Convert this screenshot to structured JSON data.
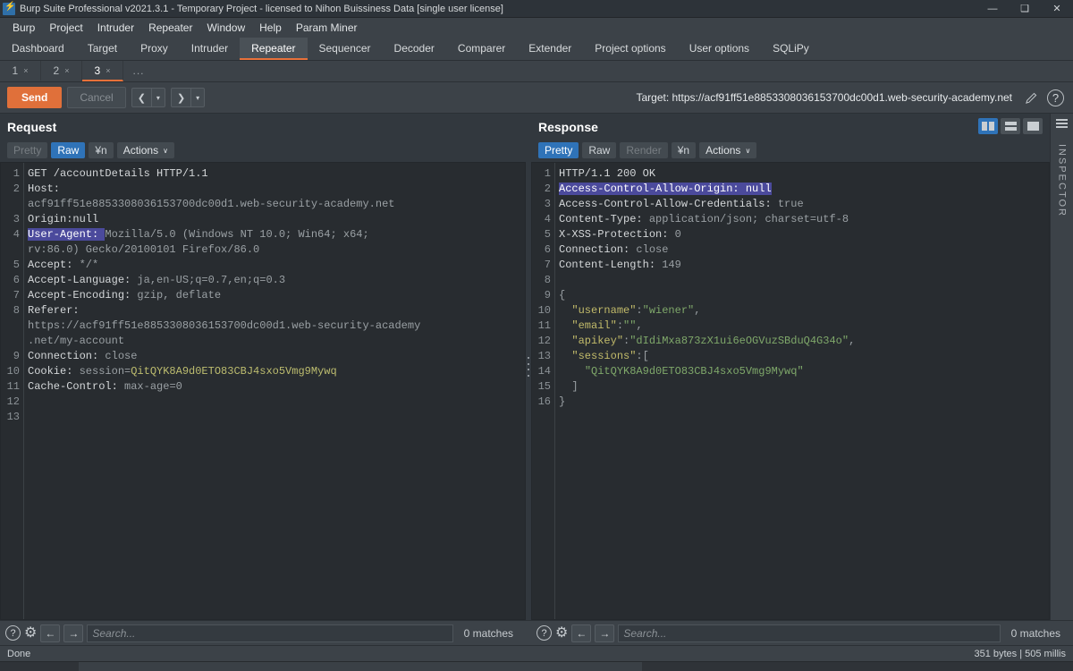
{
  "window": {
    "title": "Burp Suite Professional v2021.3.1 - Temporary Project - licensed to Nihon Buissiness Data [single user license]",
    "logo_icon": "burp-logo-icon",
    "minimize": "—",
    "maximize": "❑",
    "close": "✕"
  },
  "menu": {
    "items": [
      {
        "label": "Burp"
      },
      {
        "label": "Project"
      },
      {
        "label": "Intruder"
      },
      {
        "label": "Repeater"
      },
      {
        "label": "Window"
      },
      {
        "label": "Help"
      },
      {
        "label": "Param Miner"
      }
    ]
  },
  "main_tabs": {
    "items": [
      {
        "label": "Dashboard",
        "active": false
      },
      {
        "label": "Target",
        "active": false
      },
      {
        "label": "Proxy",
        "active": false
      },
      {
        "label": "Intruder",
        "active": false
      },
      {
        "label": "Repeater",
        "active": true
      },
      {
        "label": "Sequencer",
        "active": false
      },
      {
        "label": "Decoder",
        "active": false
      },
      {
        "label": "Comparer",
        "active": false
      },
      {
        "label": "Extender",
        "active": false
      },
      {
        "label": "Project options",
        "active": false
      },
      {
        "label": "User options",
        "active": false
      },
      {
        "label": "SQLiPy",
        "active": false
      }
    ]
  },
  "sub_tabs": {
    "items": [
      {
        "label": "1",
        "close": "×",
        "active": false
      },
      {
        "label": "2",
        "close": "×",
        "active": false
      },
      {
        "label": "3",
        "close": "×",
        "active": true
      }
    ],
    "more_label": "..."
  },
  "toolbar": {
    "send_label": "Send",
    "cancel_label": "Cancel",
    "back_icon": "chevron-left-icon",
    "back_caret": "▾",
    "forward_icon": "chevron-right-icon",
    "forward_caret": "▾",
    "target_label": "Target: https://acf91ff51e8853308036153700dc00d1.web-security-academy.net",
    "edit_icon": "pencil-icon",
    "help_icon": "question-mark-icon",
    "help_glyph": "?"
  },
  "request": {
    "title": "Request",
    "view_tabs": [
      {
        "label": "Pretty",
        "state": "disabled"
      },
      {
        "label": "Raw",
        "state": "active"
      },
      {
        "label": "¥n",
        "state": "plain"
      },
      {
        "label": "Actions",
        "state": "actions",
        "caret": "∨"
      }
    ],
    "line_numbers": [
      "1",
      "2",
      "",
      "3",
      "4",
      "",
      "5",
      "6",
      "7",
      "8",
      "",
      "",
      "9",
      "10",
      "11",
      "12",
      "13"
    ],
    "lines": [
      {
        "segments": [
          {
            "text": "GET /accountDetails HTTP/1.1",
            "cls": "hdr"
          }
        ]
      },
      {
        "segments": [
          {
            "text": "Host: ",
            "cls": "hdr"
          }
        ]
      },
      {
        "segments": [
          {
            "text": "acf91ff51e8853308036153700dc00d1.web-security-academy.net",
            "cls": "val"
          }
        ]
      },
      {
        "segments": [
          {
            "text": "Origin:null",
            "cls": "hdr"
          }
        ]
      },
      {
        "segments": [
          {
            "text": "User-Agent: ",
            "cls": "sel"
          },
          {
            "text": "Mozilla/5.0 (Windows NT 10.0; Win64; x64;",
            "cls": "val"
          }
        ]
      },
      {
        "segments": [
          {
            "text": "rv:86.0) Gecko/20100101 Firefox/86.0",
            "cls": "val"
          }
        ]
      },
      {
        "segments": [
          {
            "text": "Accept: ",
            "cls": "hdr"
          },
          {
            "text": "*/*",
            "cls": "val"
          }
        ]
      },
      {
        "segments": [
          {
            "text": "Accept-Language: ",
            "cls": "hdr"
          },
          {
            "text": "ja,en-US;q=0.7,en;q=0.3",
            "cls": "val"
          }
        ]
      },
      {
        "segments": [
          {
            "text": "Accept-Encoding: ",
            "cls": "hdr"
          },
          {
            "text": "gzip, deflate",
            "cls": "val"
          }
        ]
      },
      {
        "segments": [
          {
            "text": "Referer: ",
            "cls": "hdr"
          }
        ]
      },
      {
        "segments": [
          {
            "text": "https://acf91ff51e8853308036153700dc00d1.web-security-academy",
            "cls": "val"
          }
        ]
      },
      {
        "segments": [
          {
            "text": ".net/my-account",
            "cls": "val"
          }
        ]
      },
      {
        "segments": [
          {
            "text": "Connection: ",
            "cls": "hdr"
          },
          {
            "text": "close",
            "cls": "val"
          }
        ]
      },
      {
        "segments": [
          {
            "text": "Cookie: ",
            "cls": "hdr"
          },
          {
            "text": "session=",
            "cls": "val"
          },
          {
            "text": "QitQYK8A9d0ETO83CBJ4sxo5Vmg9Mywq",
            "cls": "cookie"
          }
        ]
      },
      {
        "segments": [
          {
            "text": "Cache-Control: ",
            "cls": "hdr"
          },
          {
            "text": "max-age=0",
            "cls": "val"
          }
        ]
      },
      {
        "segments": [
          {
            "text": "",
            "cls": "val"
          }
        ]
      },
      {
        "segments": [
          {
            "text": "",
            "cls": "val"
          }
        ]
      }
    ],
    "search": {
      "help_glyph": "?",
      "gear_icon": "gear-icon",
      "prev_icon": "arrow-left-icon",
      "prev_glyph": "←",
      "next_icon": "arrow-right-icon",
      "next_glyph": "→",
      "placeholder": "Search...",
      "value": "",
      "matches": "0 matches"
    }
  },
  "response": {
    "title": "Response",
    "view_tabs": [
      {
        "label": "Pretty",
        "state": "active"
      },
      {
        "label": "Raw",
        "state": "plain"
      },
      {
        "label": "Render",
        "state": "disabled"
      },
      {
        "label": "¥n",
        "state": "plain"
      },
      {
        "label": "Actions",
        "state": "actions",
        "caret": "∨"
      }
    ],
    "layout_buttons": [
      {
        "icon": "split-vertical-icon",
        "active": true
      },
      {
        "icon": "split-horizontal-icon",
        "active": false
      },
      {
        "icon": "single-pane-icon",
        "active": false
      }
    ],
    "line_numbers": [
      "1",
      "2",
      "3",
      "4",
      "5",
      "6",
      "7",
      "8",
      "9",
      "10",
      "11",
      "12",
      "13",
      "14",
      "15",
      "16"
    ],
    "lines": [
      {
        "segments": [
          {
            "text": "HTTP/1.1 200 OK",
            "cls": "hdr"
          }
        ]
      },
      {
        "segments": [
          {
            "text": "Access-Control-Allow-Origin: null",
            "cls": "sel"
          }
        ]
      },
      {
        "segments": [
          {
            "text": "Access-Control-Allow-Credentials: ",
            "cls": "hdr"
          },
          {
            "text": "true",
            "cls": "val"
          }
        ]
      },
      {
        "segments": [
          {
            "text": "Content-Type: ",
            "cls": "hdr"
          },
          {
            "text": "application/json; charset=utf-8",
            "cls": "val"
          }
        ]
      },
      {
        "segments": [
          {
            "text": "X-XSS-Protection: ",
            "cls": "hdr"
          },
          {
            "text": "0",
            "cls": "val"
          }
        ]
      },
      {
        "segments": [
          {
            "text": "Connection: ",
            "cls": "hdr"
          },
          {
            "text": "close",
            "cls": "val"
          }
        ]
      },
      {
        "segments": [
          {
            "text": "Content-Length: ",
            "cls": "hdr"
          },
          {
            "text": "149",
            "cls": "val"
          }
        ]
      },
      {
        "segments": [
          {
            "text": "",
            "cls": "val"
          }
        ]
      },
      {
        "segments": [
          {
            "text": "{",
            "cls": "punct"
          }
        ]
      },
      {
        "segments": [
          {
            "text": "  \"username\"",
            "cls": "jkey"
          },
          {
            "text": ":",
            "cls": "punct"
          },
          {
            "text": "\"wiener\"",
            "cls": "jval"
          },
          {
            "text": ",",
            "cls": "punct"
          }
        ]
      },
      {
        "segments": [
          {
            "text": "  \"email\"",
            "cls": "jkey"
          },
          {
            "text": ":",
            "cls": "punct"
          },
          {
            "text": "\"\"",
            "cls": "jval"
          },
          {
            "text": ",",
            "cls": "punct"
          }
        ]
      },
      {
        "segments": [
          {
            "text": "  \"apikey\"",
            "cls": "jkey"
          },
          {
            "text": ":",
            "cls": "punct"
          },
          {
            "text": "\"dIdiMxa873zX1ui6eOGVuzSBduQ4G34o\"",
            "cls": "jval"
          },
          {
            "text": ",",
            "cls": "punct"
          }
        ]
      },
      {
        "segments": [
          {
            "text": "  \"sessions\"",
            "cls": "jkey"
          },
          {
            "text": ":[",
            "cls": "punct"
          }
        ]
      },
      {
        "segments": [
          {
            "text": "    \"QitQYK8A9d0ETO83CBJ4sxo5Vmg9Mywq\"",
            "cls": "jval"
          }
        ]
      },
      {
        "segments": [
          {
            "text": "  ]",
            "cls": "punct"
          }
        ]
      },
      {
        "segments": [
          {
            "text": "}",
            "cls": "punct"
          }
        ]
      }
    ],
    "search": {
      "help_glyph": "?",
      "gear_icon": "gear-icon",
      "prev_icon": "arrow-left-icon",
      "prev_glyph": "←",
      "next_icon": "arrow-right-icon",
      "next_glyph": "→",
      "placeholder": "Search...",
      "value": "",
      "matches": "0 matches"
    }
  },
  "inspector": {
    "label": "INSPECTOR",
    "toggle_icon": "hamburger-icon"
  },
  "statusbar": {
    "left": "Done",
    "right": "351 bytes | 505 millis"
  },
  "colors": {
    "accent_orange": "#e0703a",
    "accent_blue": "#2f73b8",
    "selection_purple": "#4b4a9c",
    "json_key": "#c2bb6a",
    "json_value": "#7fa86a",
    "cookie_value": "#bdbd6f"
  }
}
